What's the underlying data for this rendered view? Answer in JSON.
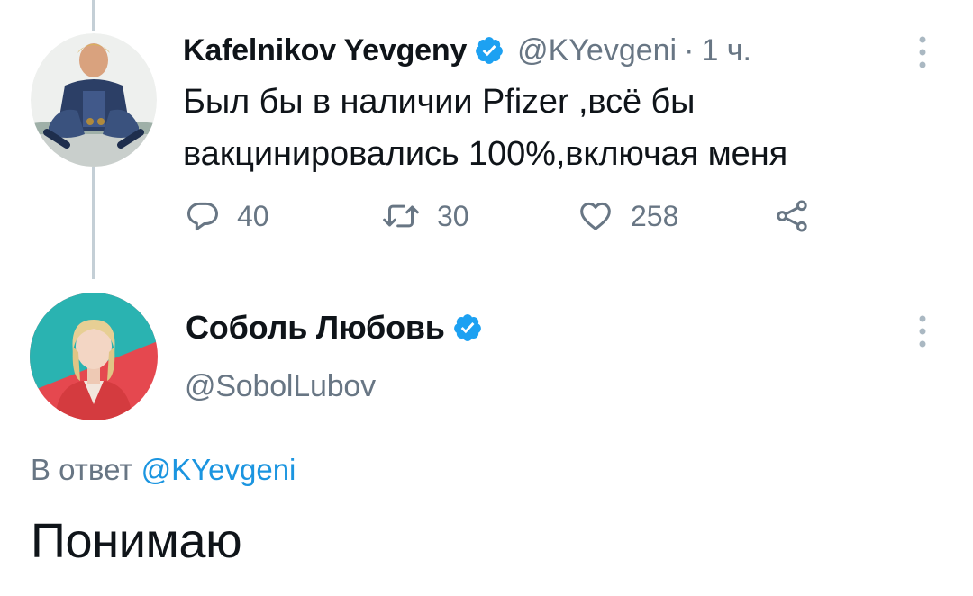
{
  "parent_tweet": {
    "author_name": "Kafelnikov Yevgeny",
    "handle": "@KYevgeni",
    "separator": "·",
    "time": "1 ч.",
    "text_line1": "Был бы в наличии Pfizer ,всё бы",
    "text_line2": "вакцинировались 100%,включая меня",
    "reply_count": "40",
    "retweet_count": "30",
    "like_count": "258",
    "verified": true
  },
  "reply_tweet": {
    "author_name": "Соболь Любовь",
    "handle": "@SobolLubov",
    "reply_prefix": "В ответ",
    "reply_mention": "@KYevgeni",
    "text": "Понимаю",
    "verified": true
  },
  "icons": {
    "verified": "verified-badge-icon",
    "reply": "speech-bubble-icon",
    "retweet": "retweet-arrows-icon",
    "like": "heart-icon",
    "share": "share-nodes-icon",
    "more": "vertical-dots-icon"
  },
  "colors": {
    "text": "#0f1419",
    "secondary": "#687684",
    "link": "#1b95e0",
    "verified": "#1da1f2",
    "thread_line": "#c4cfd6"
  }
}
